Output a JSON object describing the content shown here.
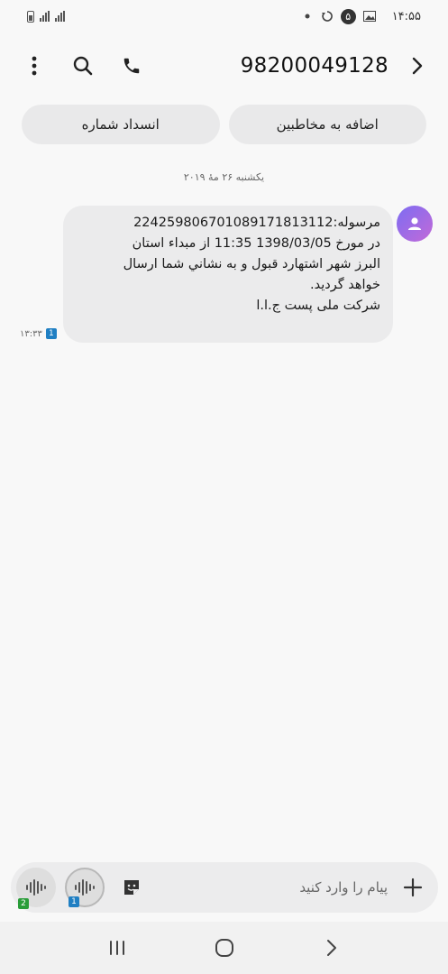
{
  "status_bar": {
    "time": "۱۴:۵۵",
    "notification_count": "۵"
  },
  "header": {
    "title": "98200049128",
    "icons": [
      "back-chevron-icon",
      "phone-icon",
      "search-icon",
      "more-vert-icon"
    ]
  },
  "actions": {
    "add_to_contacts": "اضافه به مخاطبین",
    "block_number": "انسداد شماره"
  },
  "conversation": {
    "date_separator": "یکشنبه ۲۶ مهٔ ۲۰۱۹",
    "message": {
      "lines": [
        "مرسوله:2242598067010891718131​12",
        " در مورخ 1398/03/05 11:35 از مبداء استان",
        "البرز شهر اشتهارد قبول و به نشاني شما ارسال",
        "خواهد گرديد.",
        "شرکت ملی پست ج.ا.ا"
      ],
      "time": "۱۳:۳۳",
      "sim": "1"
    }
  },
  "composer": {
    "placeholder": "پیام را وارد کنید",
    "voice_sim_2": "2",
    "voice_sim_1": "1"
  },
  "colors": {
    "background": "#f8f8f8",
    "bubble": "#ebebec",
    "sim1": "#1f7fc3",
    "sim2": "#2a9d39",
    "avatar_gradient_start": "#7d6cf2",
    "avatar_gradient_end": "#c26ad8"
  }
}
